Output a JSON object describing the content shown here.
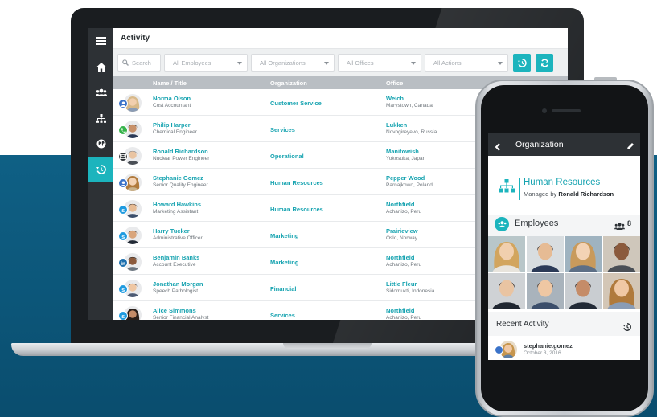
{
  "laptop_app": {
    "nav": [
      {
        "icon": "hamburger-menu-icon"
      },
      {
        "icon": "home-icon"
      },
      {
        "icon": "users-icon"
      },
      {
        "icon": "org-chart-icon"
      },
      {
        "icon": "globe-icon"
      },
      {
        "icon": "history-icon",
        "active": true
      }
    ],
    "title": "Activity",
    "filters": {
      "search_placeholder": "Search",
      "employees": "All Employees",
      "organizations": "All Organizations",
      "offices": "All Offices",
      "actions": "All Actions"
    },
    "columns": {
      "name": "Name / Title",
      "organization": "Organization",
      "office": "Office"
    },
    "rows": [
      {
        "name": "Norma Olson",
        "title": "Cost Accountant",
        "organization": "Customer Service",
        "office": "Weich",
        "location": "Marystown, Canada",
        "badge": "user",
        "badge_color": "#3b73c9"
      },
      {
        "name": "Philip Harper",
        "title": "Chemical Engineer",
        "organization": "Services",
        "office": "Lukken",
        "location": "Novogireyevo, Russia",
        "badge": "phone",
        "badge_color": "#35b34a"
      },
      {
        "name": "Ronald Richardson",
        "title": "Nuclear Power Engineer",
        "organization": "Operational",
        "office": "Manitowish",
        "location": "Yokosuka, Japan",
        "badge": "mail",
        "badge_color": "#2d3135"
      },
      {
        "name": "Stephanie Gomez",
        "title": "Senior Quality Engineer",
        "organization": "Human Resources",
        "office": "Pepper Wood",
        "location": "Parnajkowo, Poland",
        "badge": "user",
        "badge_color": "#3b73c9"
      },
      {
        "name": "Howard Hawkins",
        "title": "Marketing Assistant",
        "organization": "Human Resources",
        "office": "Northfield",
        "location": "Achanizo, Peru",
        "badge": "skype",
        "badge_color": "#1f9be0"
      },
      {
        "name": "Harry Tucker",
        "title": "Administrative Officer",
        "organization": "Marketing",
        "office": "Prairieview",
        "location": "Oslo, Norway",
        "badge": "skype",
        "badge_color": "#1f9be0"
      },
      {
        "name": "Benjamin Banks",
        "title": "Account Executive",
        "organization": "Marketing",
        "office": "Northfield",
        "location": "Achanizo, Peru",
        "badge": "linkedin",
        "badge_color": "#1c6fae"
      },
      {
        "name": "Jonathan Morgan",
        "title": "Speech Pathologist",
        "organization": "Financial",
        "office": "Little Fleur",
        "location": "Sidomukti, Indonesia",
        "badge": "skype",
        "badge_color": "#1f9be0"
      },
      {
        "name": "Alice Simmons",
        "title": "Senior Financial Analyst",
        "organization": "Services",
        "office": "Northfield",
        "location": "Achanizo, Peru",
        "badge": "skype",
        "badge_color": "#1f9be0"
      }
    ]
  },
  "phone_app": {
    "header_title": "Organization",
    "org_name": "Human Resources",
    "managed_by_prefix": "Managed by",
    "manager": "Ronald Richardson",
    "employees_label": "Employees",
    "employees_count": "8",
    "recent_activity_label": "Recent Activity",
    "activity": {
      "user": "stephanie.gomez",
      "date": "October 3, 2016"
    }
  },
  "colors": {
    "accent": "#1cb4bd",
    "nav_bg": "#2d3135",
    "link": "#16a3b0",
    "backdrop": "#0c5a7e"
  }
}
